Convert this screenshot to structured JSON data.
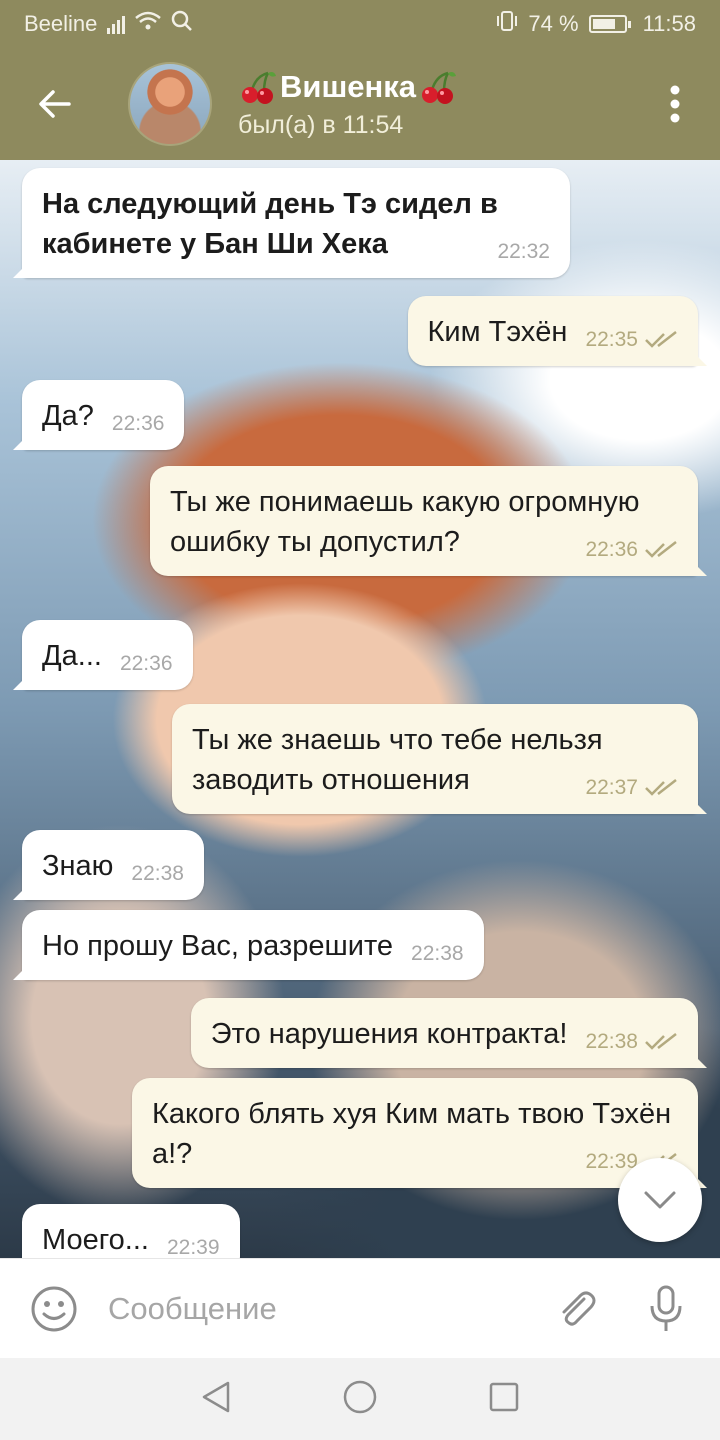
{
  "status_bar": {
    "carrier": "Beeline",
    "battery": "74 %",
    "battery_level": 0.74,
    "time": "11:58"
  },
  "header": {
    "title": "Вишенка",
    "status": "был(а) в 11:54"
  },
  "messages": [
    {
      "direction": "in",
      "text": "На следующий день Тэ сидел в кабинете у Бан Ши Хека",
      "time": "22:32",
      "bold": true
    },
    {
      "direction": "out",
      "text": "Ким Тэхён",
      "time": "22:35",
      "read": true
    },
    {
      "direction": "in",
      "text": "Да?",
      "time": "22:36"
    },
    {
      "direction": "out",
      "text": "Ты же понимаешь какую огромную ошибку ты допустил?",
      "time": "22:36",
      "read": true
    },
    {
      "direction": "in",
      "text": "Да...",
      "time": "22:36"
    },
    {
      "direction": "out",
      "text": "Ты же знаешь что тебе нельзя заводить отношения",
      "time": "22:37",
      "read": true
    },
    {
      "direction": "in",
      "text": "Знаю",
      "time": "22:38"
    },
    {
      "direction": "in",
      "text": "Но прошу Вас, разрешите",
      "time": "22:38"
    },
    {
      "direction": "out",
      "text": "Это нарушения контракта!",
      "time": "22:38",
      "read": true
    },
    {
      "direction": "out",
      "text": "Какого блять хуя Ким мать твою Тэхён а!?",
      "time": "22:39",
      "read": true
    },
    {
      "direction": "in",
      "text": "Моего...",
      "time": "22:39"
    }
  ],
  "input": {
    "placeholder": "Сообщение"
  },
  "colors": {
    "header": "#8e8a5e",
    "incoming_bubble": "#ffffff",
    "outgoing_bubble": "#fbf7e6",
    "read_ticks": "#b3aa7f"
  }
}
